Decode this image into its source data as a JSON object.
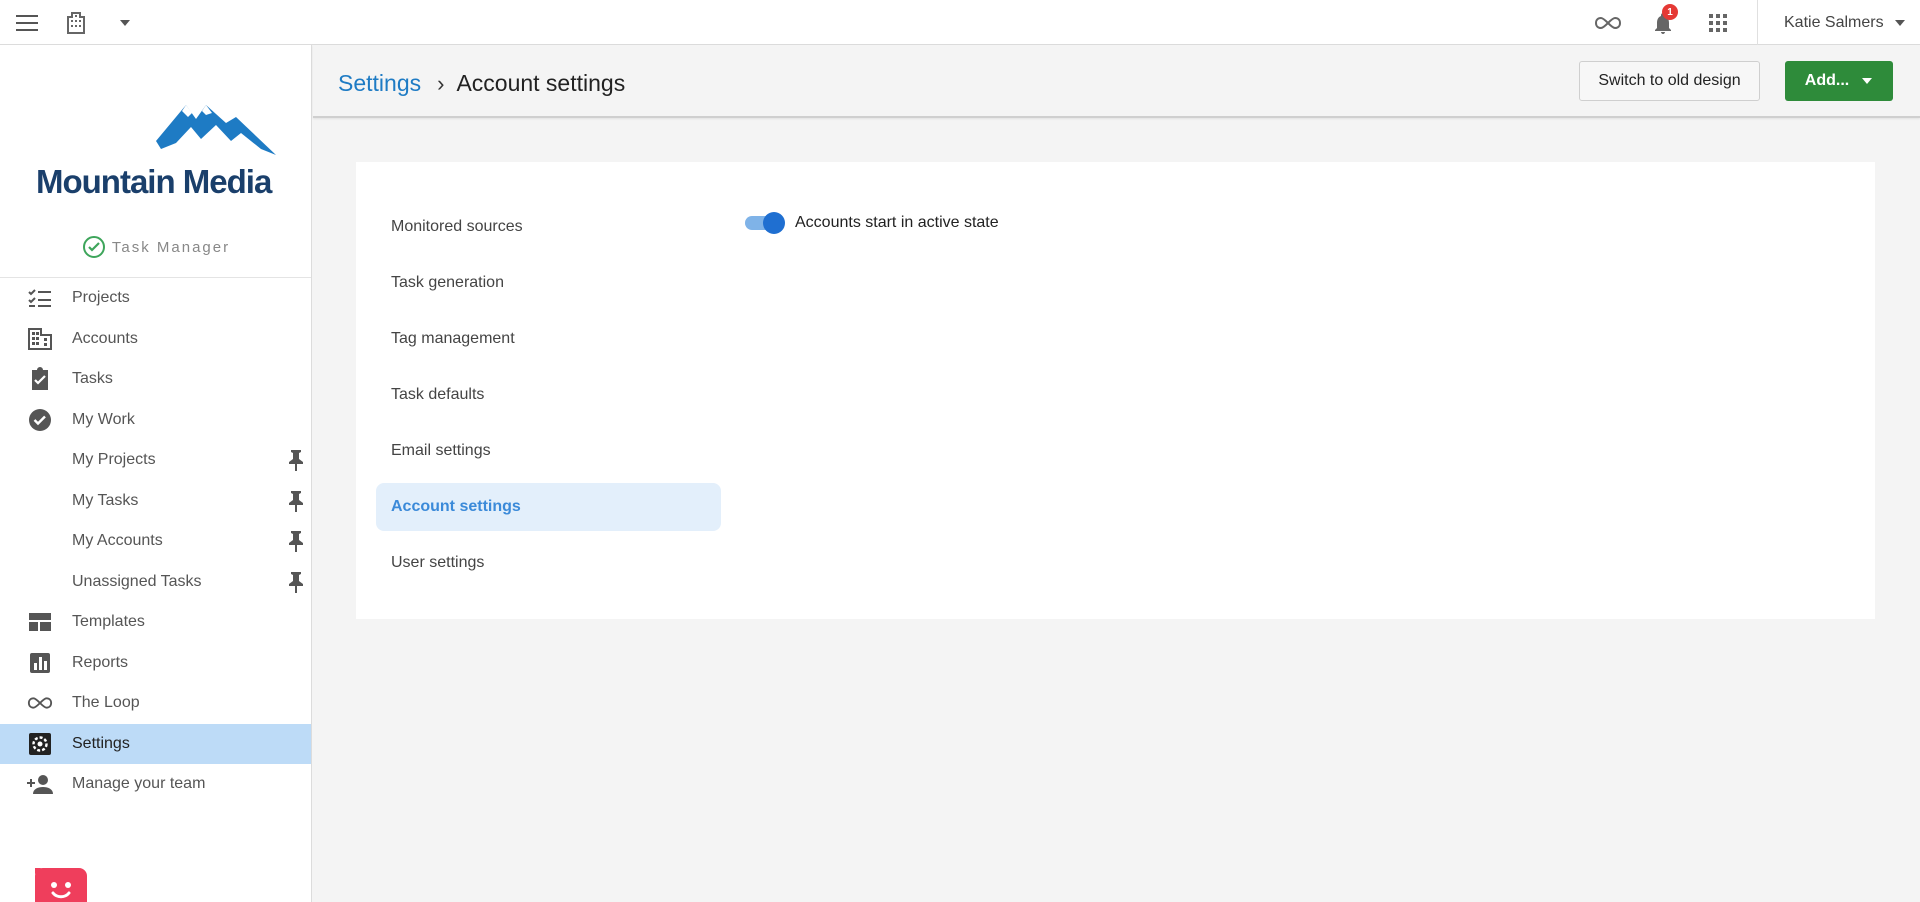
{
  "topbar": {
    "notification_count": "1",
    "user_name": "Katie Salmers"
  },
  "sidebar": {
    "logo_text": "Mountain Media",
    "app_label": "Task Manager",
    "items": [
      {
        "label": "Projects",
        "icon": "checklist-icon"
      },
      {
        "label": "Accounts",
        "icon": "building-icon"
      },
      {
        "label": "Tasks",
        "icon": "clipboard-check-icon"
      },
      {
        "label": "My Work",
        "icon": "check-circle-icon"
      },
      {
        "label": "My Projects",
        "pinned": true
      },
      {
        "label": "My Tasks",
        "pinned": true
      },
      {
        "label": "My Accounts",
        "pinned": true
      },
      {
        "label": "Unassigned Tasks",
        "pinned": true
      },
      {
        "label": "Templates",
        "icon": "template-icon"
      },
      {
        "label": "Reports",
        "icon": "bar-chart-icon"
      },
      {
        "label": "The Loop",
        "icon": "infinity-icon"
      },
      {
        "label": "Settings",
        "icon": "gear-icon",
        "active": true
      },
      {
        "label": "Manage your team",
        "icon": "add-person-icon"
      }
    ]
  },
  "header": {
    "breadcrumb_root": "Settings",
    "breadcrumb_sep": "›",
    "breadcrumb_current": "Account settings",
    "switch_button": "Switch to old design",
    "add_button": "Add..."
  },
  "settings_menu": {
    "items": [
      {
        "label": "Monitored sources"
      },
      {
        "label": "Task generation"
      },
      {
        "label": "Tag management"
      },
      {
        "label": "Task defaults"
      },
      {
        "label": "Email settings"
      },
      {
        "label": "Account settings",
        "active": true
      },
      {
        "label": "User settings"
      }
    ]
  },
  "account_settings": {
    "toggle_label": "Accounts start in active state",
    "toggle_on": true
  },
  "colors": {
    "brand_blue": "#1e7bc4",
    "add_green": "#2e8b3a",
    "active_nav_bg": "#bddbf7",
    "badge_red": "#e53935"
  }
}
